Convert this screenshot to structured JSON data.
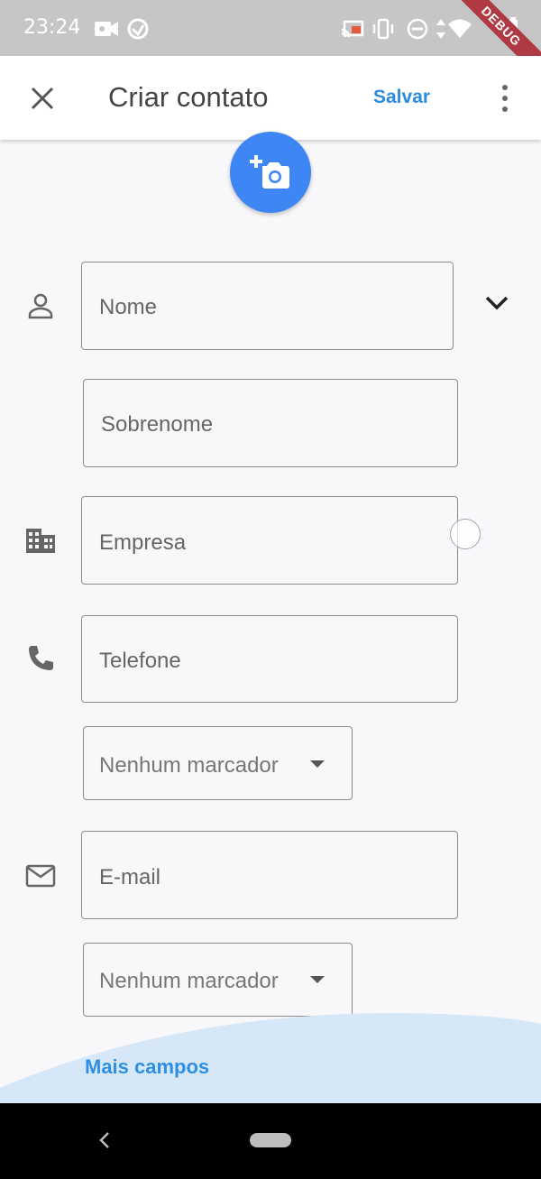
{
  "status_bar": {
    "time": "23:24",
    "debug_badge": "DEBUG",
    "icons": [
      "video-camera-icon",
      "sync-icon",
      "cast-icon",
      "vibrate-icon",
      "do-not-disturb-icon",
      "data-arrows-icon",
      "wifi-icon",
      "battery-icon"
    ]
  },
  "appbar": {
    "title": "Criar contato",
    "save_label": "Salvar",
    "close_icon": "close-icon",
    "more_icon": "more-vert-icon"
  },
  "photo": {
    "icon": "add-a-photo-icon",
    "color": "#3d86f4"
  },
  "fields": {
    "name_placeholder": "Nome",
    "surname_placeholder": "Sobrenome",
    "company_placeholder": "Empresa",
    "phone_placeholder": "Telefone",
    "phone_label_select": "Nenhum marcador",
    "email_placeholder": "E-mail",
    "email_label_select": "Nenhum marcador"
  },
  "more_fields_label": "Mais campos",
  "colors": {
    "accent": "#2c8ce0",
    "wave": "#d6e8f8",
    "status_bar": "#c6c6c6"
  }
}
